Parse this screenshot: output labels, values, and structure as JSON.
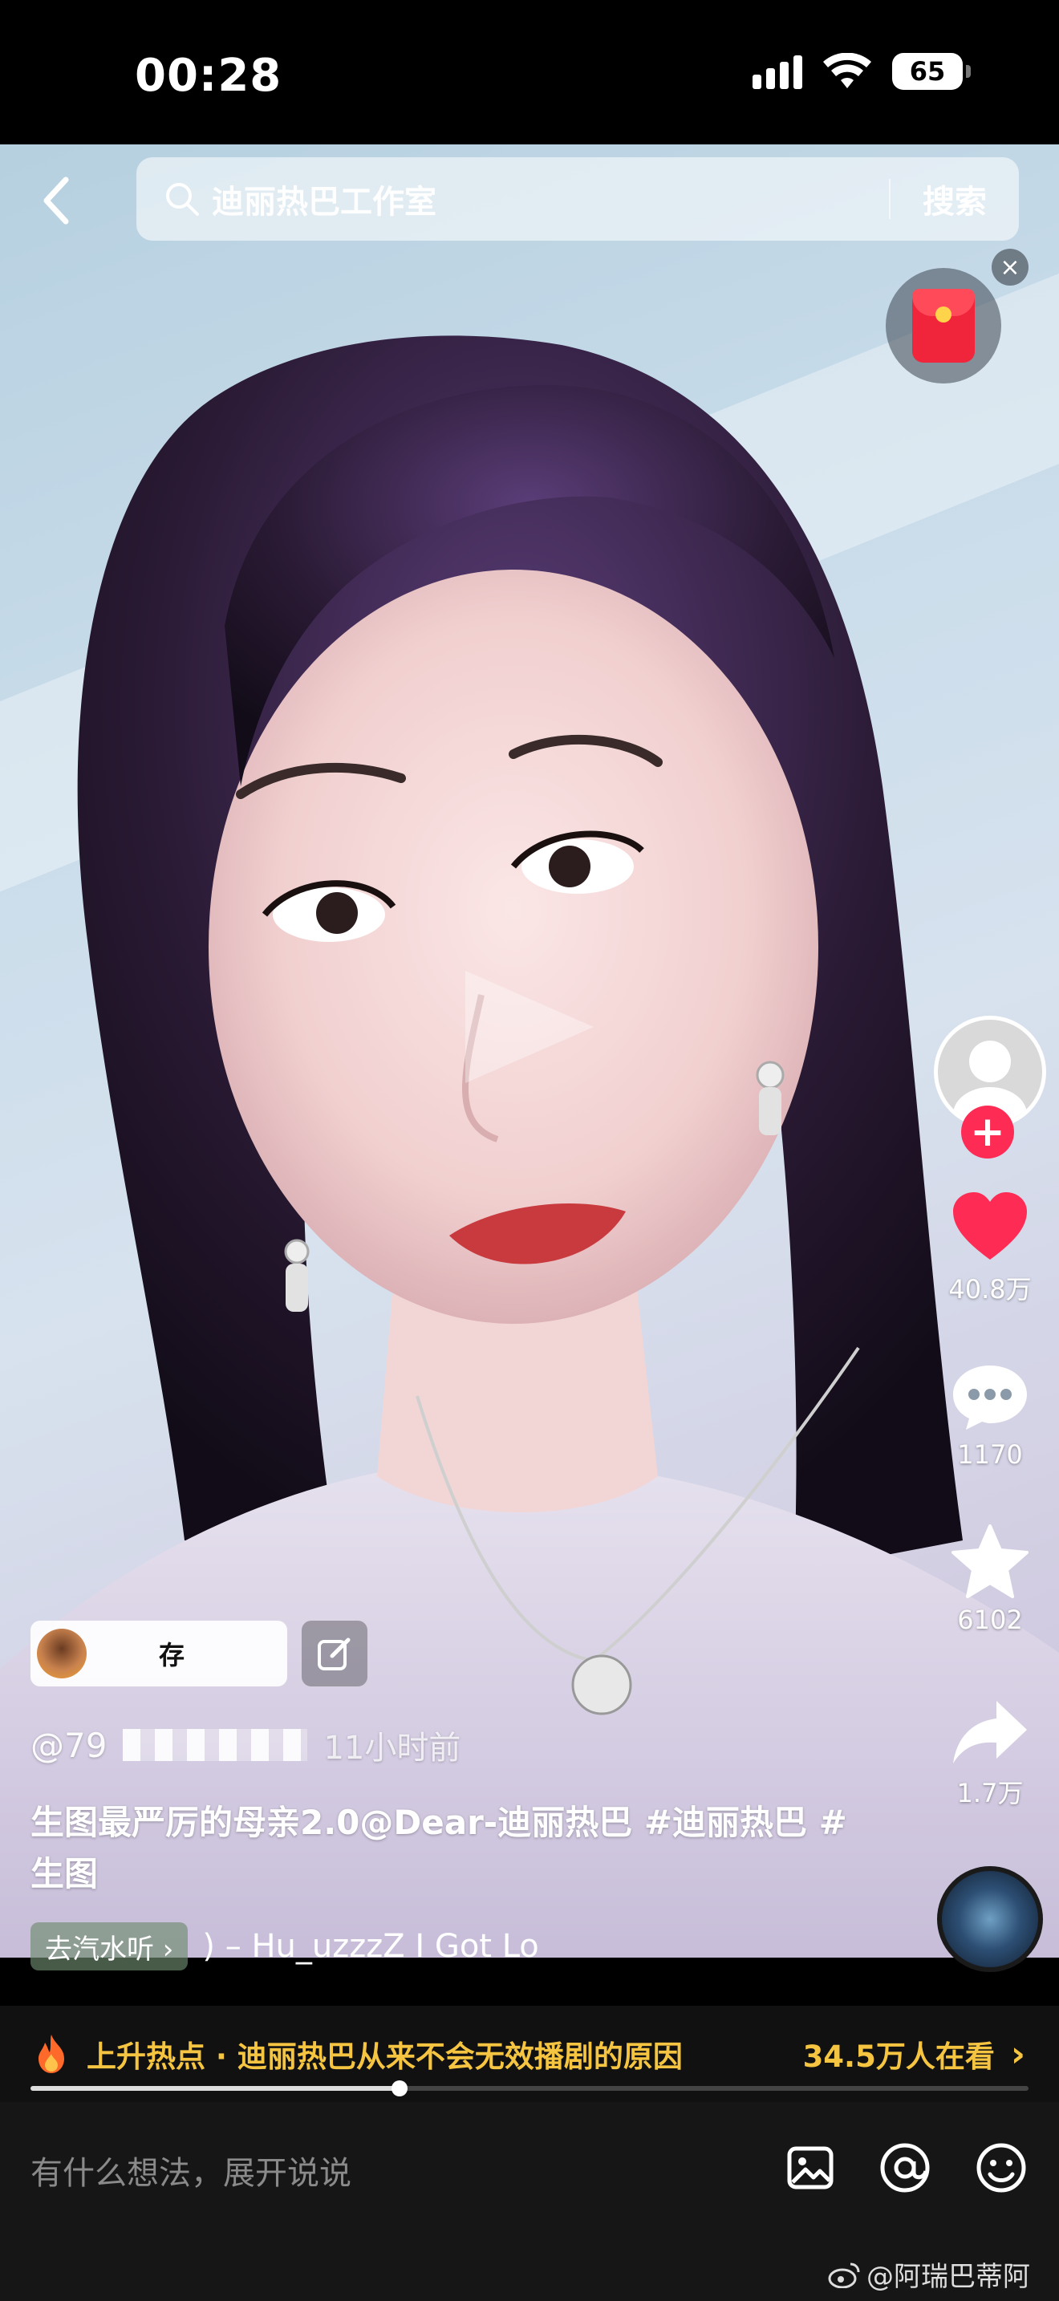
{
  "status_bar": {
    "time": "00:28",
    "battery": "65"
  },
  "search": {
    "query": "迪丽热巴工作室",
    "button_label": "搜索"
  },
  "red_packet": {
    "close_label": "×"
  },
  "right_rail": {
    "follow_label": "+",
    "likes": "40.8万",
    "comments": "1170",
    "favorites": "6102",
    "shares": "1.7万"
  },
  "post": {
    "chip_text": "存",
    "author_prefix": "@79",
    "time_ago": "11小时前",
    "caption": "生图最严厉的母亲2.0@Dear-迪丽热巴 #迪丽热巴 #生图",
    "music_chip": "去汽水听 ›",
    "music_title": ") – Hu_uzzzZ    I Got Lo"
  },
  "hot_bar": {
    "text": "上升热点 · 迪丽热巴从来不会无效播剧的原因",
    "viewers": "34.5万人在看",
    "chevron": "›",
    "progress": 0.37
  },
  "comment_bar": {
    "placeholder": "有什么想法，展开说说"
  },
  "watermark": "@阿瑞巴蒂阿",
  "colors": {
    "like": "#fe2c55",
    "hot_text": "#f5c542",
    "follow": "#fe2c55"
  },
  "icons": [
    "back-arrow-icon",
    "search-icon",
    "red-packet-icon",
    "close-icon",
    "heart-icon",
    "comment-bubble-icon",
    "star-icon",
    "share-arrow-icon",
    "fire-icon",
    "image-icon",
    "at-icon",
    "emoji-icon",
    "weibo-icon",
    "edit-icon",
    "play-icon"
  ]
}
